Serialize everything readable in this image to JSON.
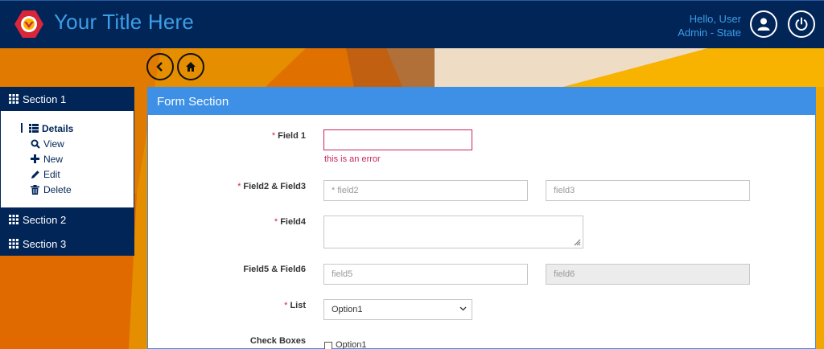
{
  "header": {
    "title": "Your Title Here",
    "greeting": "Hello, User",
    "role": "Admin - State",
    "user_icon": "user-icon",
    "power_icon": "power-icon",
    "logo_icon": "logo-icon"
  },
  "nav": {
    "back_icon": "chevron-left-icon",
    "home_icon": "home-icon"
  },
  "sidebar": {
    "sections": [
      {
        "label": "Section 1",
        "items": [
          {
            "label": "Details",
            "icon": "list-icon",
            "active": true
          },
          {
            "label": "View",
            "icon": "search-icon"
          },
          {
            "label": "New",
            "icon": "plus-icon"
          },
          {
            "label": "Edit",
            "icon": "pencil-icon"
          },
          {
            "label": "Delete",
            "icon": "trash-icon"
          }
        ]
      },
      {
        "label": "Section 2"
      },
      {
        "label": "Section 3"
      }
    ]
  },
  "form": {
    "title": "Form Section",
    "field1": {
      "label": "Field 1",
      "required": "*",
      "value": "",
      "error": "this is an error"
    },
    "field23": {
      "label": "Field2 & Field3",
      "required": "*",
      "placeholder2": "* field2",
      "placeholder3": "field3"
    },
    "field4": {
      "label": "Field4",
      "required": "*",
      "value": ""
    },
    "field56": {
      "label": "Field5 & Field6",
      "placeholder5": "field5",
      "placeholder6": "field6"
    },
    "list": {
      "label": "List",
      "required": "*",
      "selected": "Option1"
    },
    "checkboxes": {
      "label": "Check Boxes",
      "options": [
        "Option1"
      ]
    }
  },
  "colors": {
    "header_bg": "#022558",
    "accent": "#3c9ee6",
    "panel_head": "#3d90e6",
    "error": "#c8265d",
    "background": "#f2a600"
  }
}
